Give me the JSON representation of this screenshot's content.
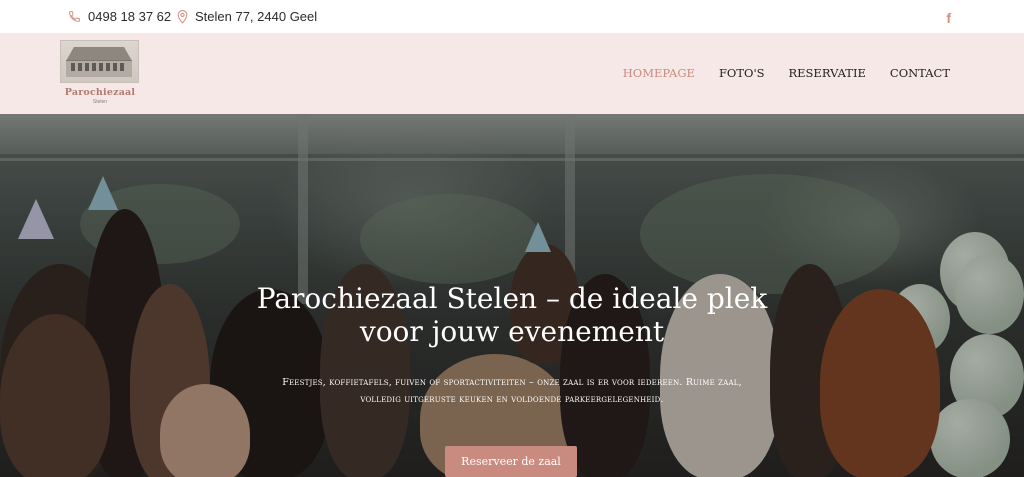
{
  "topbar": {
    "phone": "0498 18 37 62",
    "address": "Stelen 77, 2440 Geel",
    "facebook_icon": "f"
  },
  "logo": {
    "title": "Parochiezaal",
    "subtitle": "Stelen"
  },
  "nav": {
    "items": [
      {
        "label": "HOMEPAGE",
        "active": true
      },
      {
        "label": "FOTO'S",
        "active": false
      },
      {
        "label": "RESERVATIE",
        "active": false
      },
      {
        "label": "CONTACT",
        "active": false
      }
    ]
  },
  "hero": {
    "title_line1": "Parochiezaal Stelen – de ideale plek",
    "title_line2": "voor jouw evenement",
    "text_line1": "Feestjes, koffietafels, fuiven of sportactiviteiten – onze zaal is er voor iedereen. Ruime zaal,",
    "text_line2": "volledig uitgeruste keuken en voldoende parkeergelegenheid.",
    "cta_label": "Reserveer de zaal"
  },
  "colors": {
    "accent": "#c98b7f",
    "header_bg": "#f6e8e6",
    "text_dark": "#1f1f1f"
  },
  "icons": [
    "phone-icon",
    "map-pin-icon",
    "facebook-icon"
  ]
}
